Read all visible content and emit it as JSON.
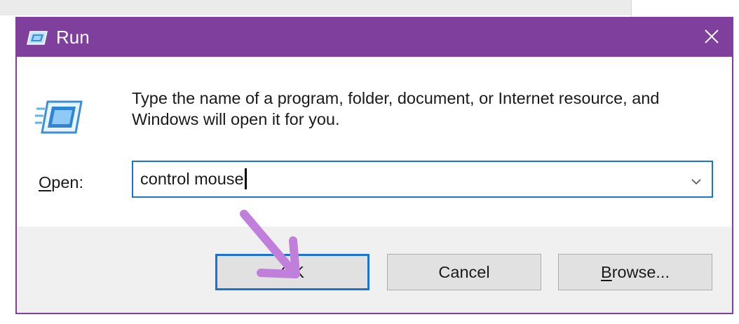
{
  "window": {
    "title": "Run",
    "accent_color": "#7e3f9d"
  },
  "dialog": {
    "description": "Type the name of a program, folder, document, or Internet resource, and Windows will open it for you.",
    "open_label_mnemonic": "O",
    "open_label_rest": "pen:",
    "input_value": "control mouse"
  },
  "buttons": {
    "ok_label": "OK",
    "cancel_label": "Cancel",
    "browse_mnemonic": "B",
    "browse_rest": "rowse..."
  },
  "icons": {
    "title_icon": "run-icon",
    "large_icon": "run-icon",
    "close_icon": "close-icon",
    "dropdown_icon": "chevron-down-icon",
    "annotation": "purple-arrow-icon"
  },
  "colors": {
    "focus_border": "#1a73d1",
    "annotation_arrow": "#c17fdc"
  }
}
